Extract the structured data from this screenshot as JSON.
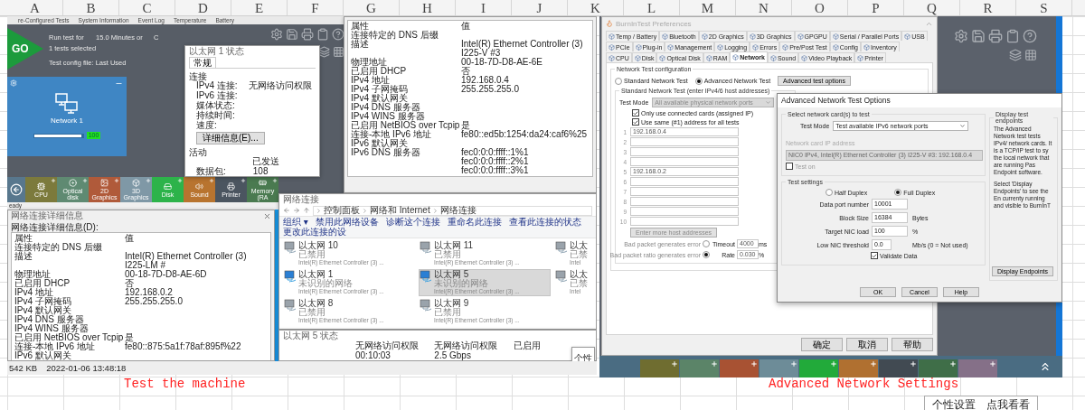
{
  "sheet": {
    "columns": [
      "A",
      "B",
      "C",
      "D",
      "E",
      "F",
      "G",
      "H",
      "I",
      "J",
      "K",
      "L",
      "M",
      "N",
      "O",
      "P",
      "Q",
      "R",
      "S"
    ]
  },
  "left_shot": {
    "burnin": {
      "menu": [
        "re-Configured Tests",
        "System Information",
        "Event Log",
        "Temperature",
        "Battery"
      ],
      "go": "GO",
      "run_label": "Run test for",
      "duration": "15.0 Minutes or",
      "cycles": "C",
      "selected_count": "1 tests selected",
      "config": "Test config file: Last Used",
      "tile": {
        "name": "Network 1",
        "level": 0.97,
        "badge": "100"
      },
      "tests": [
        {
          "label": "CPU",
          "color": "#7c7a3c"
        },
        {
          "label": "Optical disk",
          "color": "#5f8a72"
        },
        {
          "label": "2D Graphics",
          "color": "#b05a3a"
        },
        {
          "label": "3D Graphics",
          "color": "#7f98a6"
        },
        {
          "label": "Disk",
          "color": "#2db34a"
        },
        {
          "label": "Sound",
          "color": "#b8742f"
        },
        {
          "label": "Printer",
          "color": "#4b5560"
        },
        {
          "label": "Memory (RA",
          "color": "#4a7a50"
        }
      ],
      "status": "eady"
    },
    "status1": {
      "title": "以太网 1 状态",
      "tab": "常规",
      "section": "连接",
      "rows": [
        {
          "label": "IPv4 连接:",
          "value": "无网络访问权限"
        },
        {
          "label": "IPv6 连接:"
        },
        {
          "label": "媒体状态:"
        },
        {
          "label": "持续时间:"
        },
        {
          "label": "速度:"
        }
      ],
      "button": "详细信息(E)...",
      "activity": "活动",
      "sent": "已发送",
      "packets_label": "数据包:",
      "packets": "108"
    },
    "details_top": {
      "rows": [
        {
          "label": "属性",
          "value": "值"
        },
        {
          "label": "连接特定的 DNS 后缀"
        },
        {
          "label": "描述",
          "value": "Intel(R) Ethernet Controller (3) I225-V #3"
        },
        {
          "label": "物理地址",
          "value": "00-18-7D-D8-AE-6E"
        },
        {
          "label": "已启用 DHCP",
          "value": "否"
        },
        {
          "label": "IPv4 地址",
          "value": "192.168.0.4"
        },
        {
          "label": "IPv4 子网掩码",
          "value": "255.255.255.0"
        },
        {
          "label": "IPv4 默认网关"
        },
        {
          "label": "IPv4 DNS 服务器"
        },
        {
          "label": "IPv4 WINS 服务器"
        },
        {
          "label": "已启用 NetBIOS over Tcpip",
          "value": "是"
        },
        {
          "label": "连接-本地 IPv6 地址",
          "value": "fe80::ed5b:1254:da24:caf6%25"
        },
        {
          "label": "IPv6 默认网关"
        },
        {
          "label": "IPv6 DNS 服务器",
          "value": "fec0:0:0:ffff::1%1"
        },
        {
          "value": "fec0:0:0:ffff::2%1"
        },
        {
          "value": "fec0:0:0:ffff::3%1"
        }
      ]
    },
    "explorer": {
      "title": "网络连接",
      "path": [
        "控制面板",
        "网络和 Internet",
        "网络连接"
      ],
      "toolbar": [
        "组织 ▾",
        "禁用此网络设备",
        "诊断这个连接",
        "重命名此连接",
        "查看此连接的状态",
        "更改此连接的设"
      ],
      "items": [
        {
          "kind": "full",
          "name": "以太网 10",
          "status": "已禁用",
          "desc": "Intel(R) Ethernet Controller (3) ...",
          "enabled": false,
          "selected": false
        },
        {
          "kind": "full",
          "name": "以太网 11",
          "status": "已禁用",
          "desc": "Intel(R) Ethernet Controller (3) ...",
          "enabled": false,
          "selected": false
        },
        {
          "kind": "partial",
          "name": "以太",
          "status": "已禁",
          "desc": "Intel",
          "enabled": false,
          "selected": false
        },
        {
          "kind": "full",
          "name": "以太网 1",
          "status": "未识别的网络",
          "desc": "Intel(R) Ethernet Controller (3) ...",
          "enabled": true,
          "selected": false
        },
        {
          "kind": "full",
          "name": "以太网 5",
          "status": "未识别的网络",
          "desc": "Intel(R) Ethernet Controller (3) ...",
          "enabled": true,
          "selected": true
        },
        {
          "kind": "partial",
          "name": "以太",
          "status": "已禁",
          "desc": "Intel",
          "enabled": false,
          "selected": false
        },
        {
          "kind": "full",
          "name": "以太网 8",
          "status": "已禁用",
          "desc": "Intel(R) Ethernet Controller (3) ...",
          "enabled": false,
          "selected": false
        },
        {
          "kind": "full",
          "name": "以太网 9",
          "status": "已禁用",
          "desc": "Intel(R) Ethernet Controller (3) ...",
          "enabled": false,
          "selected": false
        }
      ]
    },
    "status5": {
      "title": "以太网 5 状态",
      "values": [
        "无网络访问权限",
        "无网络访问权限",
        "已启用",
        "00:10:03",
        "2.5 Gbps"
      ]
    },
    "details_bottom": {
      "title": "网络连接详细信息",
      "label": "网络连接详细信息(D):",
      "rows": [
        {
          "label": "属性",
          "value": "值"
        },
        {
          "label": "连接特定的 DNS 后缀"
        },
        {
          "label": "描述",
          "value": "Intel(R) Ethernet Controller (3) I225-LM #"
        },
        {
          "label": "物理地址",
          "value": "00-18-7D-D8-AE-6D"
        },
        {
          "label": "已启用 DHCP",
          "value": "否"
        },
        {
          "label": "IPv4 地址",
          "value": "192.168.0.2"
        },
        {
          "label": "IPv4 子网掩码",
          "value": "255.255.255.0"
        },
        {
          "label": "IPv4 默认网关"
        },
        {
          "label": "IPv4 DNS 服务器"
        },
        {
          "label": "IPv4 WINS 服务器"
        },
        {
          "label": "已启用 NetBIOS over Tcpip",
          "value": "是"
        },
        {
          "label": "连接-本地 IPv6 地址",
          "value": "fe80::875:5a1f:78af:895f%22"
        },
        {
          "label": "IPv6 默认网关"
        }
      ]
    },
    "tooltip": "个性",
    "footer": {
      "size": "542 KB",
      "time": "2022-01-06 13:48:18"
    }
  },
  "caption_left": "Test the machine",
  "right_shot": {
    "prefs": {
      "title": "BurnInTest Preferences",
      "tab_rows": [
        [
          {
            "label": "Temp / Battery",
            "selected": false
          },
          {
            "label": "Bluetooth",
            "selected": false
          },
          {
            "label": "2D Graphics",
            "selected": false
          },
          {
            "label": "3D Graphics",
            "selected": false
          },
          {
            "label": "GPGPU",
            "selected": false
          },
          {
            "label": "Serial / Parallel Ports",
            "selected": false
          },
          {
            "label": "USB",
            "selected": false
          }
        ],
        [
          {
            "label": "PCIe",
            "selected": false
          },
          {
            "label": "Plug-in",
            "selected": false
          },
          {
            "label": "Management",
            "selected": false
          },
          {
            "label": "Logging",
            "selected": false
          },
          {
            "label": "Errors",
            "selected": false
          },
          {
            "label": "Pre/Post Test",
            "selected": false
          },
          {
            "label": "Config",
            "selected": false
          },
          {
            "label": "Inventory",
            "selected": false
          }
        ],
        [
          {
            "label": "CPU",
            "selected": false
          },
          {
            "label": "Disk",
            "selected": false
          },
          {
            "label": "Optical Disk",
            "selected": false
          },
          {
            "label": "RAM",
            "selected": false
          },
          {
            "label": "Network",
            "selected": true
          },
          {
            "label": "Sound",
            "selected": false
          },
          {
            "label": "Video Playback",
            "selected": false
          },
          {
            "label": "Printer",
            "selected": false
          }
        ]
      ],
      "config_title": "Network Test configuration",
      "modes": [
        {
          "label": "Standard Network Test",
          "selected": false
        },
        {
          "label": "Advanced Network Test",
          "selected": true
        }
      ],
      "adv_button": "Advanced test options",
      "std_title": "Standard Network Test (enter IPv4/6 host addresses)",
      "test_mode_label": "Test Mode",
      "test_mode": "All available physical network ports",
      "checks": [
        {
          "label": "Only use connected cards (assigned IP)",
          "checked": true
        },
        {
          "label": "Use same (#1) address for all tests",
          "checked": true
        }
      ],
      "hosts": [
        {
          "num": "1",
          "value": "192.168.0.4"
        },
        {
          "num": "2"
        },
        {
          "num": "3"
        },
        {
          "num": "4"
        },
        {
          "num": "5",
          "value": "192.168.0.2"
        },
        {
          "num": "6"
        },
        {
          "num": "7"
        },
        {
          "num": "8"
        },
        {
          "num": "9"
        },
        {
          "num": "10"
        }
      ],
      "more_button": "Enter more host addresses",
      "errors": [
        {
          "label": "Bad packet generates error",
          "selected": false,
          "field_label": "Timeout",
          "value": "4000",
          "unit": "ms"
        },
        {
          "label": "Bad packet ratio generates error",
          "selected": true,
          "field_label": "Rate",
          "value": "0.030",
          "unit": "%"
        }
      ],
      "buttons": [
        "确定",
        "取消",
        "帮助"
      ]
    },
    "adv": {
      "title": "Advanced Network Test Options",
      "card_group": "Select network card(s) to test",
      "test_mode_label": "Test Mode",
      "test_mode": "Test available IPv6 network ports",
      "ip_label": "Network card IP address",
      "ip_value": "NIC0 IPv4, Intel(R) Ethernet Controller (3) I225-V #3: 192.168.0.4",
      "test_on": {
        "label": "Test on",
        "checked": false
      },
      "settings_group": "Test settings",
      "duplex": [
        {
          "label": "Half Duplex",
          "selected": false
        },
        {
          "label": "Full Duplex",
          "selected": true
        }
      ],
      "fields": [
        {
          "label": "Data port number",
          "value": "10001"
        },
        {
          "label": "Block Size",
          "value": "16384",
          "unit": "Bytes"
        },
        {
          "label": "Target NIC load",
          "value": "100",
          "unit": "%"
        },
        {
          "label": "Low NIC threshold",
          "value": "0.0",
          "unit": "Mb/s (0 = Not used)"
        }
      ],
      "validate": {
        "label": "Validate Data",
        "checked": true
      },
      "endpoints_group": "Display test endpoints",
      "endpoints_text": [
        "The Advanced Network test tests IPv4/ network cards. It is a TCP/IP test to sy the local network that are running Pas Endpoint software.",
        "Select 'Display Endpoints' to see the En currenty running and visible to BurnInT"
      ],
      "endpoints_button": "Display Endpoints",
      "buttons": [
        "OK",
        "Cancel",
        "Help"
      ]
    },
    "tiles": [
      {
        "color": "#6f6d30"
      },
      {
        "color": "#5b8468"
      },
      {
        "color": "#a85233"
      },
      {
        "color": "#6d8c98"
      },
      {
        "color": "#22aa3a"
      },
      {
        "color": "#b07030"
      },
      {
        "color": "#414a52"
      },
      {
        "color": "#3f6e48"
      },
      {
        "color": "#857088"
      }
    ]
  },
  "caption_right": "Advanced Network Settings",
  "popup": "个性设置　点我看看"
}
